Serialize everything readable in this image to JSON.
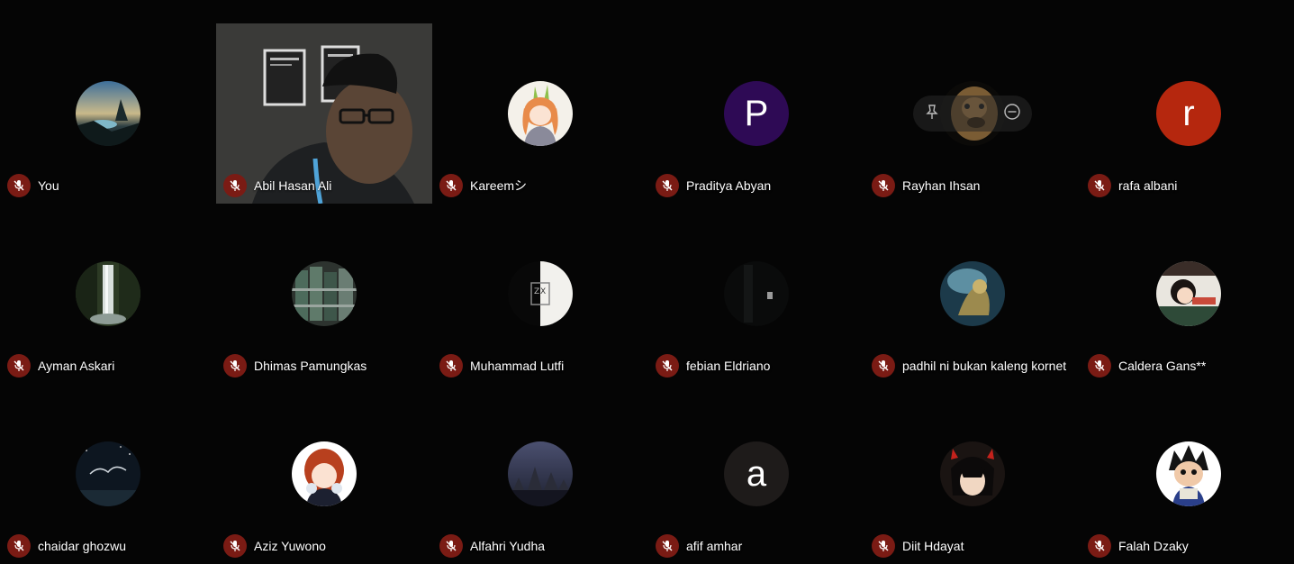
{
  "participants": [
    {
      "name": "You"
    },
    {
      "name": "Abil Hasan Ali"
    },
    {
      "name": "Kareemシ"
    },
    {
      "name": "Praditya Abyan",
      "initial": "P",
      "color": "#2e0a55"
    },
    {
      "name": "Rayhan Ihsan"
    },
    {
      "name": "rafa albani",
      "initial": "r",
      "color": "#b5270e"
    },
    {
      "name": "Ayman Askari"
    },
    {
      "name": "Dhimas Pamungkas"
    },
    {
      "name": "Muhammad Lutfi"
    },
    {
      "name": "febian Eldriano"
    },
    {
      "name": "padhil ni bukan kaleng kornet"
    },
    {
      "name": "Caldera Gans**"
    },
    {
      "name": "chaidar ghozwu"
    },
    {
      "name": "Aziz Yuwono"
    },
    {
      "name": "Alfahri Yudha"
    },
    {
      "name": "afif amhar",
      "initial": "a",
      "color": "#1e1b1a"
    },
    {
      "name": "Diit Hdayat"
    },
    {
      "name": "Falah Dzaky"
    }
  ],
  "icons": {
    "mic": "mic-off-icon",
    "pin": "pin-icon",
    "remove": "remove-icon"
  },
  "colors": {
    "background": "#050505",
    "muted_badge": "#7a1b14"
  }
}
